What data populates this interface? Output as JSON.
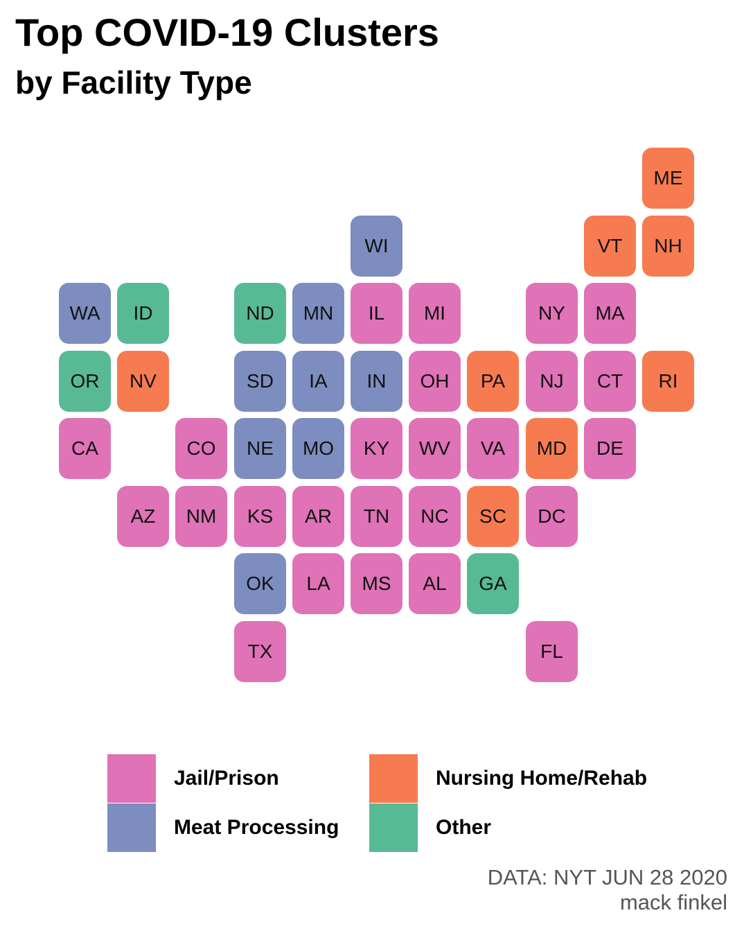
{
  "title": "Top COVID-19 Clusters",
  "subtitle": "by Facility Type",
  "categories": {
    "jail": {
      "label": "Jail/Prison",
      "color": "#E072B7"
    },
    "meat": {
      "label": "Meat Processing",
      "color": "#7D8DBF"
    },
    "nursing": {
      "label": "Nursing Home/Rehab",
      "color": "#F77B50"
    },
    "other": {
      "label": "Other",
      "color": "#58BA94"
    }
  },
  "states": [
    {
      "abbr": "ME",
      "row": 0,
      "col": 10,
      "type": "nursing"
    },
    {
      "abbr": "WI",
      "row": 1,
      "col": 5,
      "type": "meat"
    },
    {
      "abbr": "VT",
      "row": 1,
      "col": 9,
      "type": "nursing"
    },
    {
      "abbr": "NH",
      "row": 1,
      "col": 10,
      "type": "nursing"
    },
    {
      "abbr": "WA",
      "row": 2,
      "col": 0,
      "type": "meat"
    },
    {
      "abbr": "ID",
      "row": 2,
      "col": 1,
      "type": "other"
    },
    {
      "abbr": "ND",
      "row": 2,
      "col": 3,
      "type": "other"
    },
    {
      "abbr": "MN",
      "row": 2,
      "col": 4,
      "type": "meat"
    },
    {
      "abbr": "IL",
      "row": 2,
      "col": 5,
      "type": "jail"
    },
    {
      "abbr": "MI",
      "row": 2,
      "col": 6,
      "type": "jail"
    },
    {
      "abbr": "NY",
      "row": 2,
      "col": 8,
      "type": "jail"
    },
    {
      "abbr": "MA",
      "row": 2,
      "col": 9,
      "type": "jail"
    },
    {
      "abbr": "OR",
      "row": 3,
      "col": 0,
      "type": "other"
    },
    {
      "abbr": "NV",
      "row": 3,
      "col": 1,
      "type": "nursing"
    },
    {
      "abbr": "SD",
      "row": 3,
      "col": 3,
      "type": "meat"
    },
    {
      "abbr": "IA",
      "row": 3,
      "col": 4,
      "type": "meat"
    },
    {
      "abbr": "IN",
      "row": 3,
      "col": 5,
      "type": "meat"
    },
    {
      "abbr": "OH",
      "row": 3,
      "col": 6,
      "type": "jail"
    },
    {
      "abbr": "PA",
      "row": 3,
      "col": 7,
      "type": "nursing"
    },
    {
      "abbr": "NJ",
      "row": 3,
      "col": 8,
      "type": "jail"
    },
    {
      "abbr": "CT",
      "row": 3,
      "col": 9,
      "type": "jail"
    },
    {
      "abbr": "RI",
      "row": 3,
      "col": 10,
      "type": "nursing"
    },
    {
      "abbr": "CA",
      "row": 4,
      "col": 0,
      "type": "jail"
    },
    {
      "abbr": "CO",
      "row": 4,
      "col": 2,
      "type": "jail"
    },
    {
      "abbr": "NE",
      "row": 4,
      "col": 3,
      "type": "meat"
    },
    {
      "abbr": "MO",
      "row": 4,
      "col": 4,
      "type": "meat"
    },
    {
      "abbr": "KY",
      "row": 4,
      "col": 5,
      "type": "jail"
    },
    {
      "abbr": "WV",
      "row": 4,
      "col": 6,
      "type": "jail"
    },
    {
      "abbr": "VA",
      "row": 4,
      "col": 7,
      "type": "jail"
    },
    {
      "abbr": "MD",
      "row": 4,
      "col": 8,
      "type": "nursing"
    },
    {
      "abbr": "DE",
      "row": 4,
      "col": 9,
      "type": "jail"
    },
    {
      "abbr": "AZ",
      "row": 5,
      "col": 1,
      "type": "jail"
    },
    {
      "abbr": "NM",
      "row": 5,
      "col": 2,
      "type": "jail"
    },
    {
      "abbr": "KS",
      "row": 5,
      "col": 3,
      "type": "jail"
    },
    {
      "abbr": "AR",
      "row": 5,
      "col": 4,
      "type": "jail"
    },
    {
      "abbr": "TN",
      "row": 5,
      "col": 5,
      "type": "jail"
    },
    {
      "abbr": "NC",
      "row": 5,
      "col": 6,
      "type": "jail"
    },
    {
      "abbr": "SC",
      "row": 5,
      "col": 7,
      "type": "nursing"
    },
    {
      "abbr": "DC",
      "row": 5,
      "col": 8,
      "type": "jail"
    },
    {
      "abbr": "OK",
      "row": 6,
      "col": 3,
      "type": "meat"
    },
    {
      "abbr": "LA",
      "row": 6,
      "col": 4,
      "type": "jail"
    },
    {
      "abbr": "MS",
      "row": 6,
      "col": 5,
      "type": "jail"
    },
    {
      "abbr": "AL",
      "row": 6,
      "col": 6,
      "type": "jail"
    },
    {
      "abbr": "GA",
      "row": 6,
      "col": 7,
      "type": "other"
    },
    {
      "abbr": "TX",
      "row": 7,
      "col": 3,
      "type": "jail"
    },
    {
      "abbr": "FL",
      "row": 7,
      "col": 8,
      "type": "jail"
    }
  ],
  "caption": {
    "source": "DATA: NYT JUN 28 2020",
    "author": "mack finkel"
  }
}
